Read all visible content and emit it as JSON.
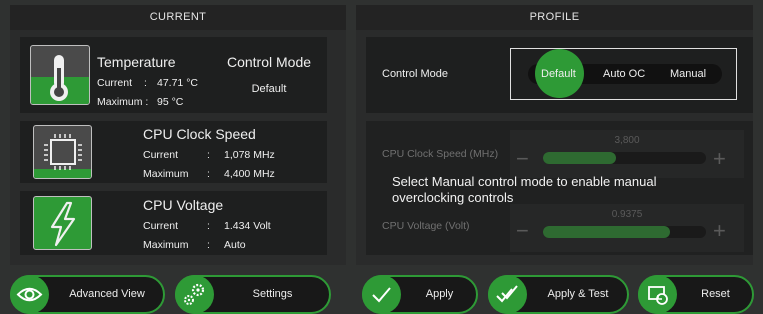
{
  "current": {
    "header": "CURRENT",
    "temperature": {
      "title": "Temperature",
      "current_label": "Current",
      "current_value": "47.71 °C",
      "maximum_label": "Maximum :",
      "maximum_value": "95 °C"
    },
    "control_mode": {
      "title": "Control Mode",
      "value": "Default"
    },
    "cpu_clock": {
      "title": "CPU Clock Speed",
      "current_label": "Current",
      "sep": ":",
      "current_value": "1,078  MHz",
      "maximum_label": "Maximum",
      "maximum_value": "4,400  MHz"
    },
    "cpu_voltage": {
      "title": "CPU Voltage",
      "current_label": "Current",
      "sep": ":",
      "current_value": "1.434  Volt",
      "maximum_label": "Maximum",
      "maximum_value": "Auto"
    }
  },
  "profile": {
    "header": "PROFILE",
    "control_mode_label": "Control Mode",
    "modes": [
      "Default",
      "Auto OC",
      "Manual"
    ],
    "selected_mode": "Default",
    "clock_label": "CPU Clock Speed (MHz)",
    "clock_value": "3,800",
    "clock_level": 0.45,
    "voltage_label": "CPU Voltage (Volt)",
    "voltage_value": "0.9375",
    "voltage_level": 0.78,
    "notice": "Select Manual control mode to enable manual overclocking controls"
  },
  "buttons": {
    "advanced_view": "Advanced View",
    "settings": "Settings",
    "apply": "Apply",
    "apply_test": "Apply & Test",
    "reset": "Reset"
  },
  "colors": {
    "accent": "#2e9a36",
    "background": "#2f3130",
    "card": "#1e1f1f"
  }
}
